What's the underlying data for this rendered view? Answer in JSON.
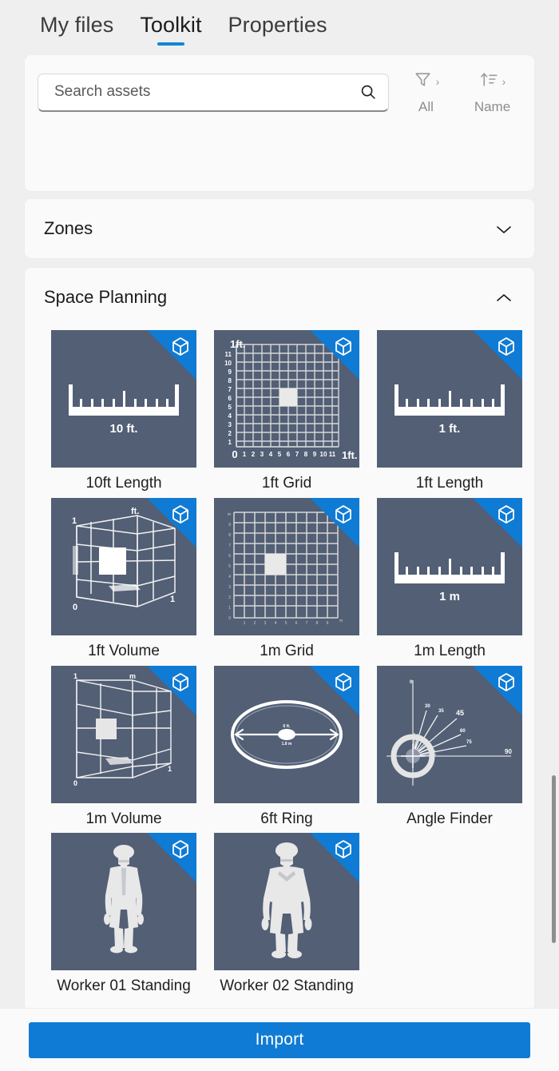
{
  "tabs": [
    {
      "label": "My files",
      "active": false
    },
    {
      "label": "Toolkit",
      "active": true
    },
    {
      "label": "Properties",
      "active": false
    }
  ],
  "search": {
    "placeholder": "Search assets",
    "value": "",
    "icon": "search-icon"
  },
  "controls": [
    {
      "icon": "filter-funnel-icon",
      "caret": "›",
      "label": "All"
    },
    {
      "icon": "sort-ascending-icon",
      "caret": "›",
      "label": "Name"
    }
  ],
  "sections": [
    {
      "title": "Zones",
      "expanded": false,
      "chevron": "chevron-down-icon"
    },
    {
      "title": "Space Planning",
      "expanded": true,
      "chevron": "chevron-up-icon"
    }
  ],
  "assets": [
    {
      "label": "10ft Length",
      "art": "length",
      "measure": "10 ft.",
      "badge": "cube-3d-icon"
    },
    {
      "label": "1ft Grid",
      "art": "grid-ft",
      "measure": "1ft.",
      "badge": "cube-3d-icon"
    },
    {
      "label": "1ft Length",
      "art": "length",
      "measure": "1 ft.",
      "badge": "cube-3d-icon"
    },
    {
      "label": "1ft Volume",
      "art": "volume-ft",
      "measure": "ft.",
      "badge": "cube-3d-icon"
    },
    {
      "label": "1m Grid",
      "art": "grid-m",
      "measure": "m",
      "badge": "cube-3d-icon"
    },
    {
      "label": "1m Length",
      "art": "length",
      "measure": "1 m",
      "badge": "cube-3d-icon"
    },
    {
      "label": "1m Volume",
      "art": "volume-m",
      "measure": "m",
      "badge": "cube-3d-icon"
    },
    {
      "label": "6ft Ring",
      "art": "ring",
      "measure": "6 ft.",
      "badge": "cube-3d-icon"
    },
    {
      "label": "Angle Finder",
      "art": "angle",
      "measure": "0 / 45 / 90",
      "badge": "cube-3d-icon"
    },
    {
      "label": "Worker 01 Standing",
      "art": "worker1",
      "measure": "",
      "badge": "cube-3d-icon"
    },
    {
      "label": "Worker 02 Standing",
      "art": "worker2",
      "measure": "",
      "badge": "cube-3d-icon"
    }
  ],
  "grid_ft_ticks": {
    "x": [
      "0",
      "1",
      "2",
      "3",
      "4",
      "5",
      "6",
      "7",
      "8",
      "9",
      "10",
      "11"
    ],
    "y": [
      "1",
      "2",
      "3",
      "4",
      "5",
      "6",
      "7",
      "8",
      "9",
      "10",
      "11"
    ],
    "corner_label": "1ft.",
    "end_label": "1ft."
  },
  "volume_ft_labels": {
    "top_left": "1",
    "top_mid": "ft.",
    "origin": "0",
    "bottom_right": "1"
  },
  "volume_m_labels": {
    "top_left": "1",
    "top_mid": "m",
    "origin": "0",
    "bottom_right": "1"
  },
  "angle_labels": {
    "zero": "0",
    "forty_five": "45",
    "ninety": "90"
  },
  "footer": {
    "import_label": "Import"
  },
  "colors": {
    "accent": "#0f7bd4",
    "tab_underline": "#0f86d8",
    "thumb_bg": "#525f75",
    "badge_blue": "#0f7bd4",
    "page_bg": "#efefef",
    "panel_bg": "#fafafa"
  }
}
